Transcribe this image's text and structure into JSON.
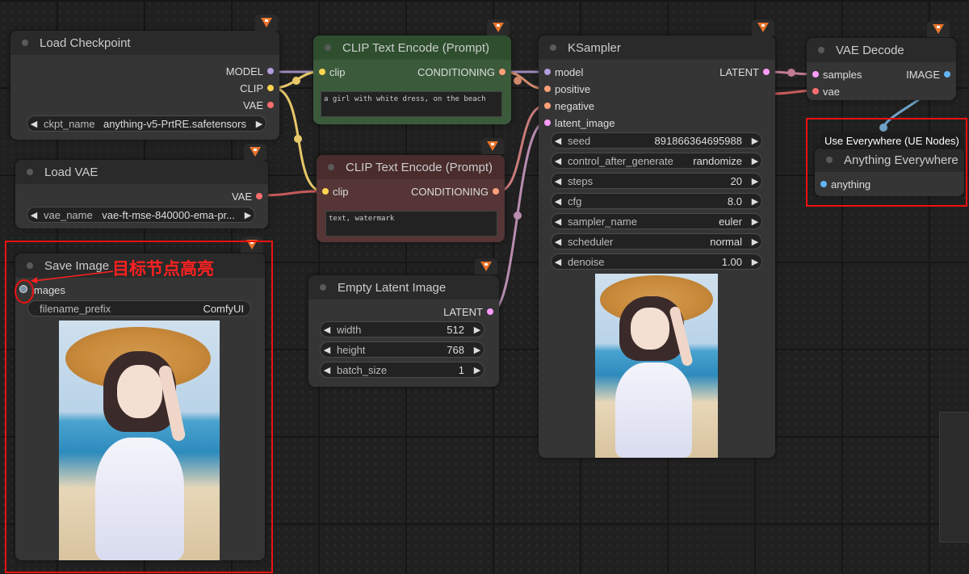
{
  "nodes": {
    "load_checkpoint": {
      "title": "Load Checkpoint",
      "outputs": [
        "MODEL",
        "CLIP",
        "VAE"
      ],
      "widget": {
        "name": "ckpt_name",
        "value": "anything-v5-PrtRE.safetensors"
      }
    },
    "load_vae": {
      "title": "Load VAE",
      "outputs": [
        "VAE"
      ],
      "widget": {
        "name": "vae_name",
        "value": "vae-ft-mse-840000-ema-pr..."
      }
    },
    "save_image": {
      "title": "Save Image",
      "inputs": [
        "images"
      ],
      "widget": {
        "name": "filename_prefix",
        "value": "ComfyUI"
      }
    },
    "clip_pos": {
      "title": "CLIP Text Encode (Prompt)",
      "input": "clip",
      "output": "CONDITIONING",
      "text": "a girl with white dress, on the beach"
    },
    "clip_neg": {
      "title": "CLIP Text Encode (Prompt)",
      "input": "clip",
      "output": "CONDITIONING",
      "text": "text, watermark"
    },
    "empty_latent": {
      "title": "Empty Latent Image",
      "output": "LATENT",
      "widgets": [
        {
          "name": "width",
          "value": "512"
        },
        {
          "name": "height",
          "value": "768"
        },
        {
          "name": "batch_size",
          "value": "1"
        }
      ]
    },
    "ksampler": {
      "title": "KSampler",
      "inputs": [
        "model",
        "positive",
        "negative",
        "latent_image"
      ],
      "output": "LATENT",
      "widgets": [
        {
          "name": "seed",
          "value": "891866364695988"
        },
        {
          "name": "control_after_generate",
          "value": "randomize"
        },
        {
          "name": "steps",
          "value": "20"
        },
        {
          "name": "cfg",
          "value": "8.0"
        },
        {
          "name": "sampler_name",
          "value": "euler"
        },
        {
          "name": "scheduler",
          "value": "normal"
        },
        {
          "name": "denoise",
          "value": "1.00"
        }
      ]
    },
    "vae_decode": {
      "title": "VAE Decode",
      "inputs": [
        "samples",
        "vae"
      ],
      "output": "IMAGE"
    },
    "anything_everywhere": {
      "title": "Anything Everywhere",
      "input": "anything",
      "tooltip": "Use Everywhere (UE Nodes)"
    }
  },
  "annotation": "目标节点高亮",
  "colors": {
    "model": "#b39ddb",
    "clip": "#ffd54f",
    "vae": "#ff6e6e",
    "conditioning": "#ffa07a",
    "latent": "#ff9cf9",
    "image": "#64b5f6",
    "clip_pos_node": "#335533",
    "clip_neg_node": "#553333",
    "highlight": "#ee1111"
  },
  "icons": [
    "fox-badge-icon",
    "arrow-left-icon",
    "arrow-right-icon"
  ]
}
